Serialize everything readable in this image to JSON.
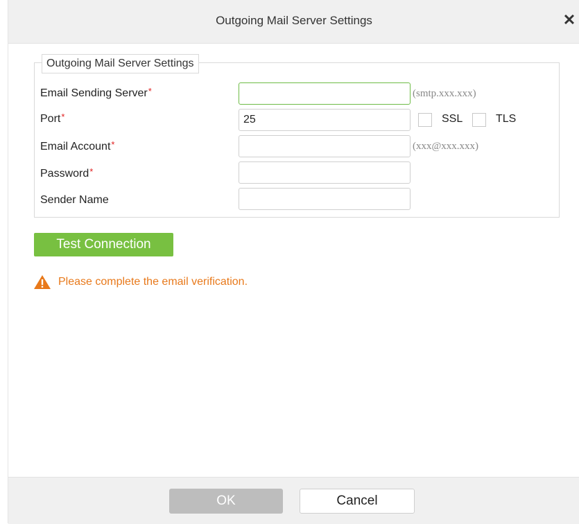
{
  "dialog": {
    "title": "Outgoing Mail Server Settings",
    "close_icon": "close-icon"
  },
  "section": {
    "legend": "Outgoing Mail Server Settings"
  },
  "fields": {
    "server": {
      "label": "Email Sending Server",
      "required": "*",
      "value": "",
      "hint": "(smtp.xxx.xxx)"
    },
    "port": {
      "label": "Port",
      "required": "*",
      "value": "25"
    },
    "account": {
      "label": "Email Account",
      "required": "*",
      "value": "",
      "hint": "(xxx@xxx.xxx)"
    },
    "password": {
      "label": "Password",
      "required": "*",
      "value": ""
    },
    "sender": {
      "label": "Sender Name",
      "value": ""
    }
  },
  "options": {
    "ssl": {
      "label": "SSL",
      "checked": false
    },
    "tls": {
      "label": "TLS",
      "checked": false
    }
  },
  "test_button": "Test Connection",
  "warning": {
    "icon": "warning-triangle-icon",
    "text": "Please complete the email verification.",
    "color": "#e8791b"
  },
  "footer": {
    "ok_label": "OK",
    "cancel_label": "Cancel"
  },
  "colors": {
    "accent_green": "#78c041",
    "required_red": "#e02020",
    "disabled_gray": "#bdbdbd"
  }
}
